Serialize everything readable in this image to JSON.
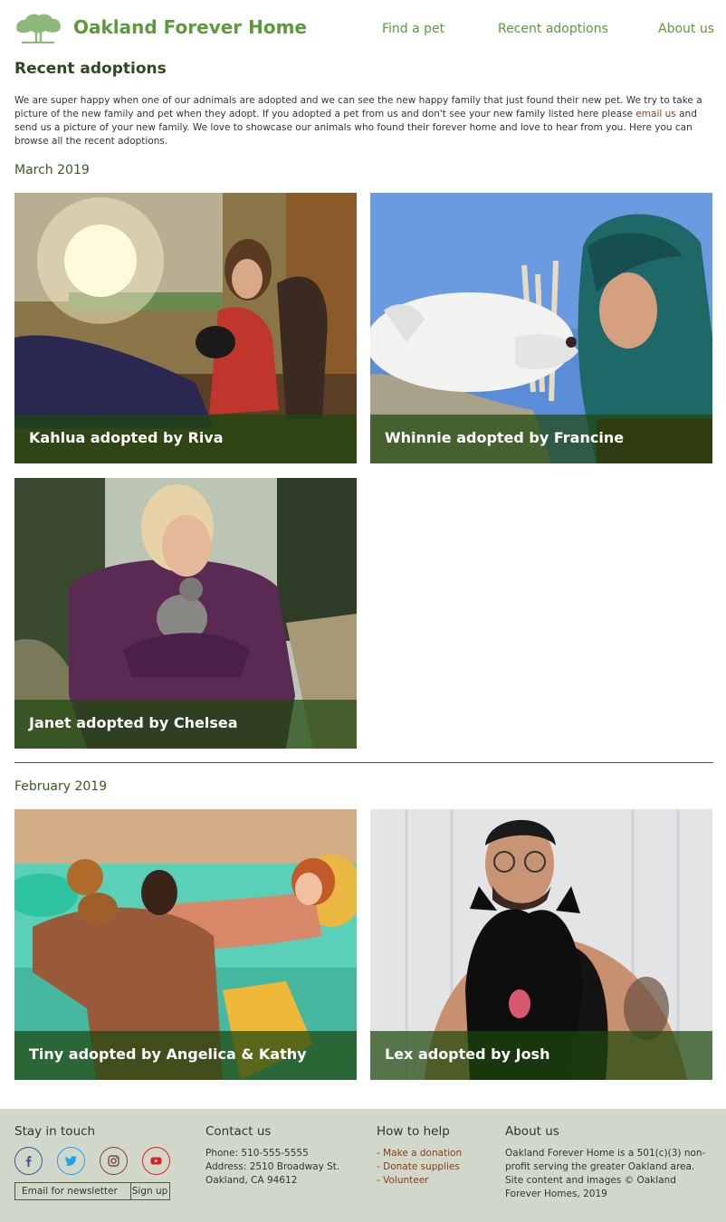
{
  "header": {
    "site_title": "Oakland Forever Home",
    "nav": [
      "Find a pet",
      "Recent adoptions",
      "About us"
    ],
    "logo_icon": "oak-tree-icon",
    "brand_color": "#5c9a3c"
  },
  "main": {
    "title": "Recent adoptions",
    "intro_before": "We are super happy when one of our adnimals are adopted and we can see the new happy family that just found their new pet.  We try to take a picture of the new family and pet when they adopt.  If you adopted a pet from us and don't see your new family listed here please ",
    "intro_link": "email us",
    "intro_after": " and send us a picture of your new family.  We love to showcase our animals who found their forever home and love to hear from you.  Here you can browse all the recent adoptions.",
    "sections": [
      {
        "month": "March 2019",
        "adoptions": [
          "Kahlua adopted by Riva",
          "Whinnie adopted by Francine",
          "Janet adopted by Chelsea"
        ]
      },
      {
        "month": "February 2019",
        "adoptions": [
          "Tiny adopted by Angelica & Kathy",
          "Lex adopted by Josh"
        ]
      }
    ]
  },
  "footer": {
    "stay_in_touch": {
      "heading": "Stay in touch",
      "social_icons": [
        "facebook-icon",
        "twitter-icon",
        "instagram-icon",
        "youtube-icon"
      ],
      "newsletter_placeholder": "Email for newsletter",
      "signup_label": "Sign up"
    },
    "contact": {
      "heading": "Contact us",
      "phone": "Phone: 510-555-5555",
      "address_line1": "Address: 2510 Broadway St.",
      "address_line2": "Oakland, CA 94612"
    },
    "help": {
      "heading": "How to help",
      "links": [
        "- Make a donation",
        "- Donate supplies",
        "- Volunteer"
      ]
    },
    "about": {
      "heading": "About us",
      "text": "Oakland Forever Home is a 501(c)(3) non-profit serving the greater Oakland area. Site content and images © Oakland Forever Homes, 2019"
    }
  }
}
